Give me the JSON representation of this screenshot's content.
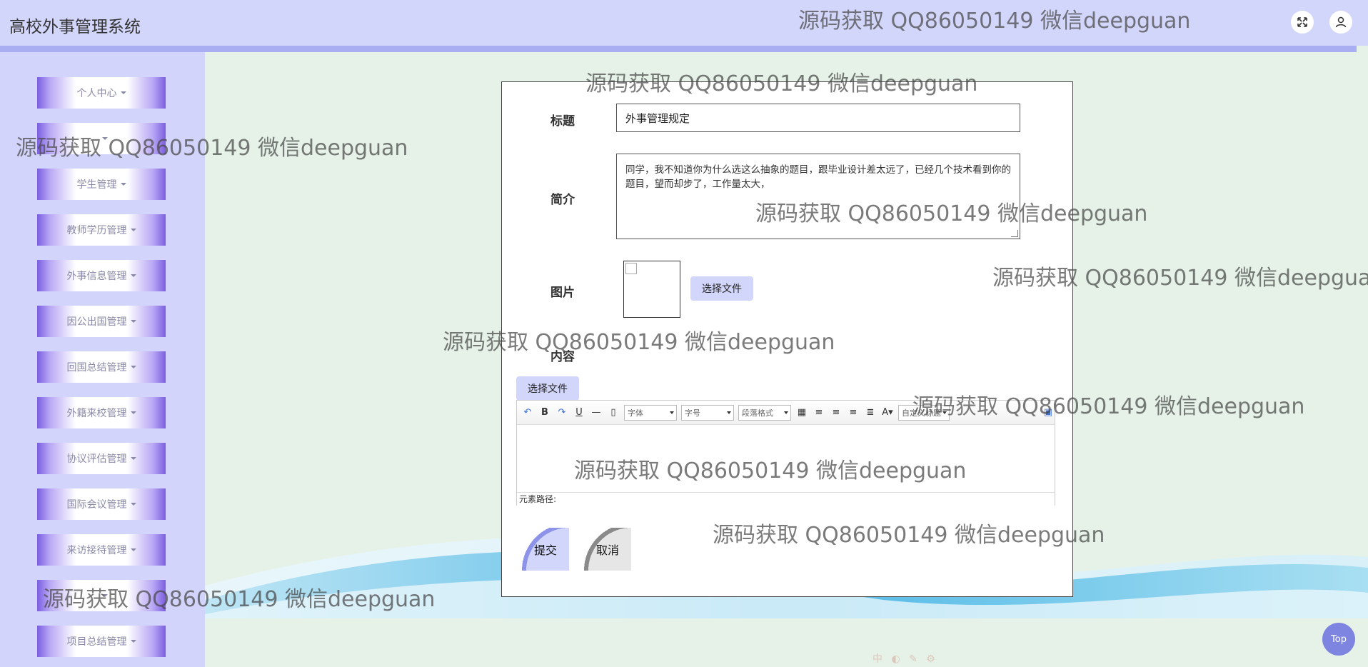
{
  "header": {
    "app_title": "高校外事管理系统"
  },
  "sidebar": {
    "items": [
      {
        "label": "个人中心"
      },
      {
        "label": " "
      },
      {
        "label": "学生管理"
      },
      {
        "label": "教师学历管理"
      },
      {
        "label": "外事信息管理"
      },
      {
        "label": "因公出国管理"
      },
      {
        "label": "回国总结管理"
      },
      {
        "label": "外籍来校管理"
      },
      {
        "label": "协议评估管理"
      },
      {
        "label": "国际会议管理"
      },
      {
        "label": "来访接待管理"
      },
      {
        "label": " "
      },
      {
        "label": "项目总结管理"
      }
    ]
  },
  "form": {
    "title_label": "标题",
    "title_value": "外事管理规定",
    "intro_label": "简介",
    "intro_value": "同学，我不知道你为什么选这么抽象的题目，跟毕业设计差太远了，已经几个技术看到你的题目，望而却步了，工作量太大，",
    "image_label": "图片",
    "file_button": "选择文件",
    "content_label": "内容",
    "content_file_button": "选择文件",
    "submit": "提交",
    "cancel": "取消"
  },
  "editor": {
    "font_select": "字体",
    "size_select": "字号",
    "paragraph_select": "段落格式",
    "custom_title_select": "自定义标题",
    "status_label": "元素路径:"
  },
  "watermark_text": "源码获取 QQ86050149 微信deepguan",
  "top_button": "Top",
  "footer_icons": "中"
}
